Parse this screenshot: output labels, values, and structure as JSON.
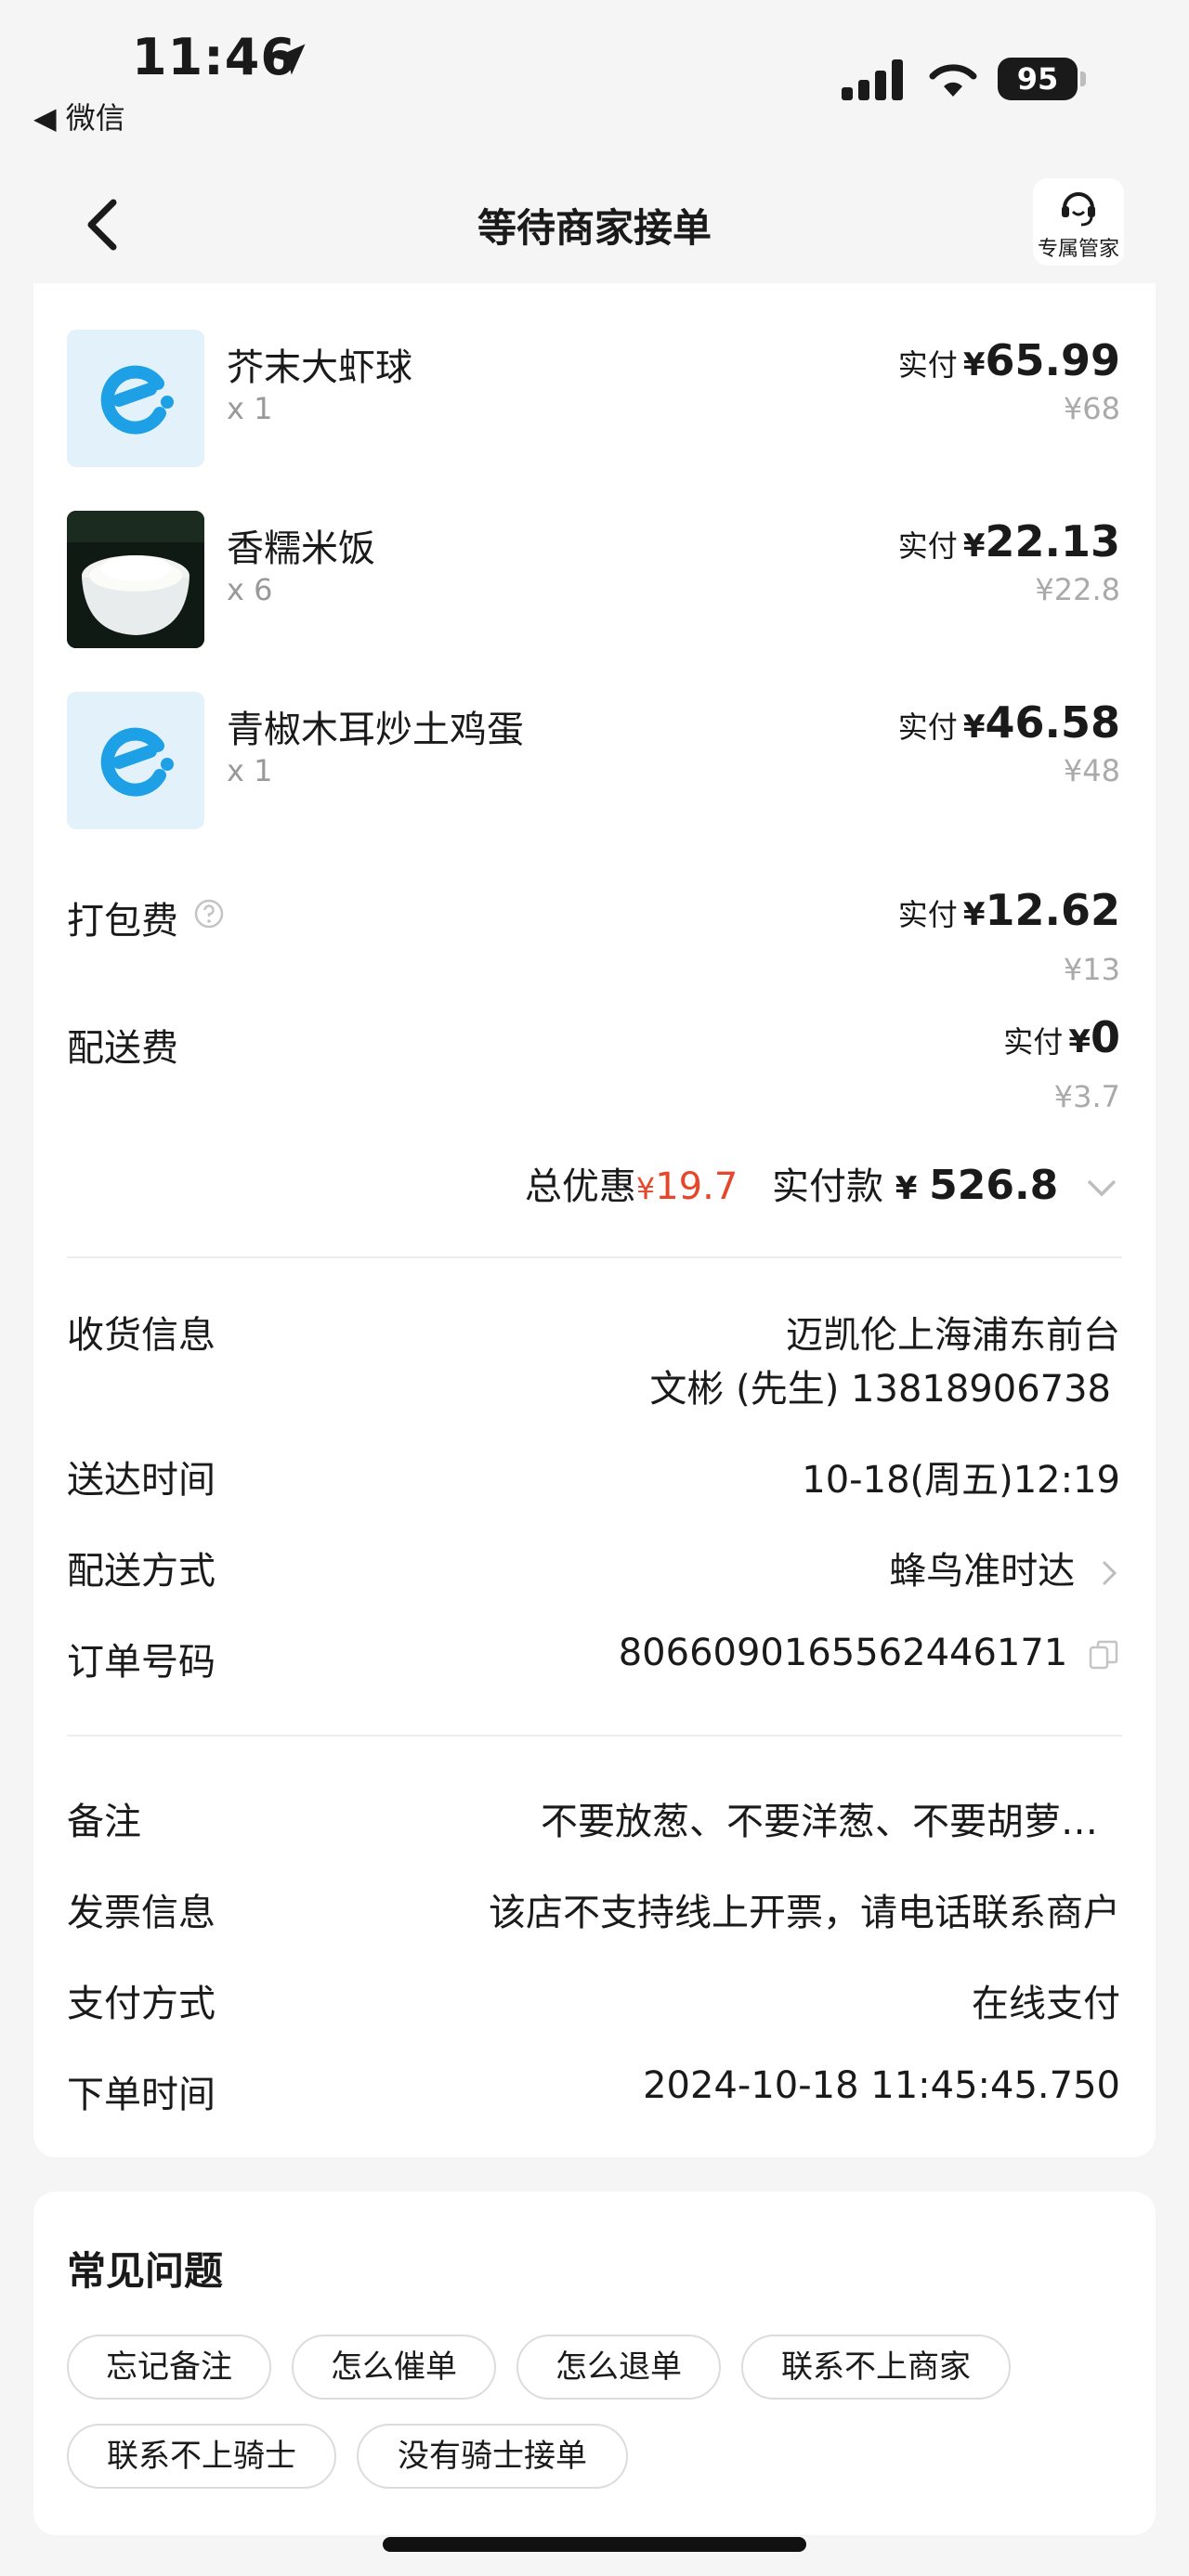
{
  "status_bar": {
    "time": "11:46",
    "back_label": "◀ 微信",
    "battery": "95"
  },
  "nav": {
    "title": "等待商家接单",
    "service_label": "专属管家"
  },
  "items": [
    {
      "name": "芥末大虾球",
      "qty": "x 1",
      "paid_prefix": "实付",
      "currency": "¥",
      "paid": "65.99",
      "original": "¥68",
      "thumb": "ele-logo-icon"
    },
    {
      "name": "香糯米饭",
      "qty": "x 6",
      "paid_prefix": "实付",
      "currency": "¥",
      "paid": "22.13",
      "original": "¥22.8",
      "thumb": "rice-bowl-photo"
    },
    {
      "name": "青椒木耳炒土鸡蛋",
      "qty": "x 1",
      "paid_prefix": "实付",
      "currency": "¥",
      "paid": "46.58",
      "original": "¥48",
      "thumb": "ele-logo-icon"
    }
  ],
  "fees": {
    "packing": {
      "label": "打包费",
      "paid_prefix": "实付",
      "currency": "¥",
      "paid": "12.62",
      "original": "¥13"
    },
    "delivery": {
      "label": "配送费",
      "paid_prefix": "实付",
      "currency": "¥",
      "paid": "0",
      "original": "¥3.7"
    }
  },
  "summary": {
    "discount_label": "总优惠",
    "discount_currency": "¥",
    "discount_value": "19.7",
    "paid_label": "实付款",
    "paid_currency": "¥",
    "paid_value": "526.8"
  },
  "delivery_info": {
    "recipient_label": "收货信息",
    "address": "迈凯伦上海浦东前台",
    "contact": "文彬 (先生) 13818906738",
    "time_label": "送达时间",
    "time_value": "10-18(周五)12:19",
    "method_label": "配送方式",
    "method_value": "蜂鸟准时达",
    "order_label": "订单号码",
    "order_value": "8066090165562446171"
  },
  "other_info": {
    "note_label": "备注",
    "note_value": "不要放葱、不要洋葱、不要胡萝…",
    "invoice_label": "发票信息",
    "invoice_value": "该店不支持线上开票，请电话联系商户",
    "payment_label": "支付方式",
    "payment_value": "在线支付",
    "order_time_label": "下单时间",
    "order_time_value": "2024-10-18 11:45:45.750"
  },
  "faq": {
    "title": "常见问题",
    "chips": [
      "忘记备注",
      "怎么催单",
      "怎么退单",
      "联系不上商家",
      "联系不上骑士",
      "没有骑士接单"
    ]
  },
  "colors": {
    "accent_red": "#e8462b",
    "brand_blue": "#1ea0e6"
  }
}
